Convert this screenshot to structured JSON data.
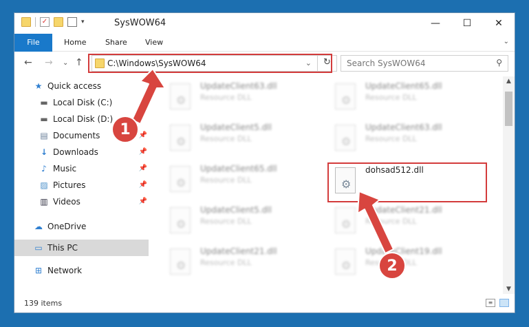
{
  "window": {
    "title": "SysWOW64",
    "controls": {
      "minimize": "—",
      "maximize": "☐",
      "close": "✕"
    }
  },
  "ribbon": {
    "tabs": [
      "File",
      "Home",
      "Share",
      "View"
    ],
    "expand": "⌄"
  },
  "nav": {
    "back": "←",
    "forward": "→",
    "recent": "⌄",
    "up": "↑",
    "address": "C:\\Windows\\SysWOW64",
    "address_dropdown": "⌄",
    "refresh": "↻",
    "search_placeholder": "Search SysWOW64",
    "search_icon": "⚲"
  },
  "sidebar": {
    "items": [
      {
        "label": "Quick access",
        "icon": "★"
      },
      {
        "label": "Local Disk (C:)",
        "icon": "▬"
      },
      {
        "label": "Local Disk (D:)",
        "icon": "▬"
      },
      {
        "label": "Documents",
        "icon": "▤"
      },
      {
        "label": "Downloads",
        "icon": "↓"
      },
      {
        "label": "Music",
        "icon": "♪"
      },
      {
        "label": "Pictures",
        "icon": "▨"
      },
      {
        "label": "Videos",
        "icon": "▥"
      },
      {
        "label": "OneDrive",
        "icon": "☁"
      },
      {
        "label": "This PC",
        "icon": "▭"
      },
      {
        "label": "Network",
        "icon": "⊞"
      }
    ],
    "pin": "📌"
  },
  "files": [
    {
      "name": "UpdateClient63.dll",
      "type": "Resource DLL"
    },
    {
      "name": "UpdateClient65.dll",
      "type": "Resource DLL"
    },
    {
      "name": "UpdateClient5.dll",
      "type": "Resource DLL"
    },
    {
      "name": "UpdateClient63.dll",
      "type": "Resource DLL"
    },
    {
      "name": "UpdateClient65.dll",
      "type": "Resource DLL"
    },
    {
      "name": "dohsad512.dll",
      "type": ""
    },
    {
      "name": "UpdateClient5.dll",
      "type": "Resource DLL"
    },
    {
      "name": "UpdateClient21.dll",
      "type": "Resource DLL"
    },
    {
      "name": "UpdateClient21.dll",
      "type": "Resource DLL"
    },
    {
      "name": "UpdateClient19.dll",
      "type": "Resource DLL"
    }
  ],
  "status": {
    "count": "139 items"
  },
  "annotations": {
    "badge1": "1",
    "badge2": "2",
    "color": "#d33b3b"
  }
}
